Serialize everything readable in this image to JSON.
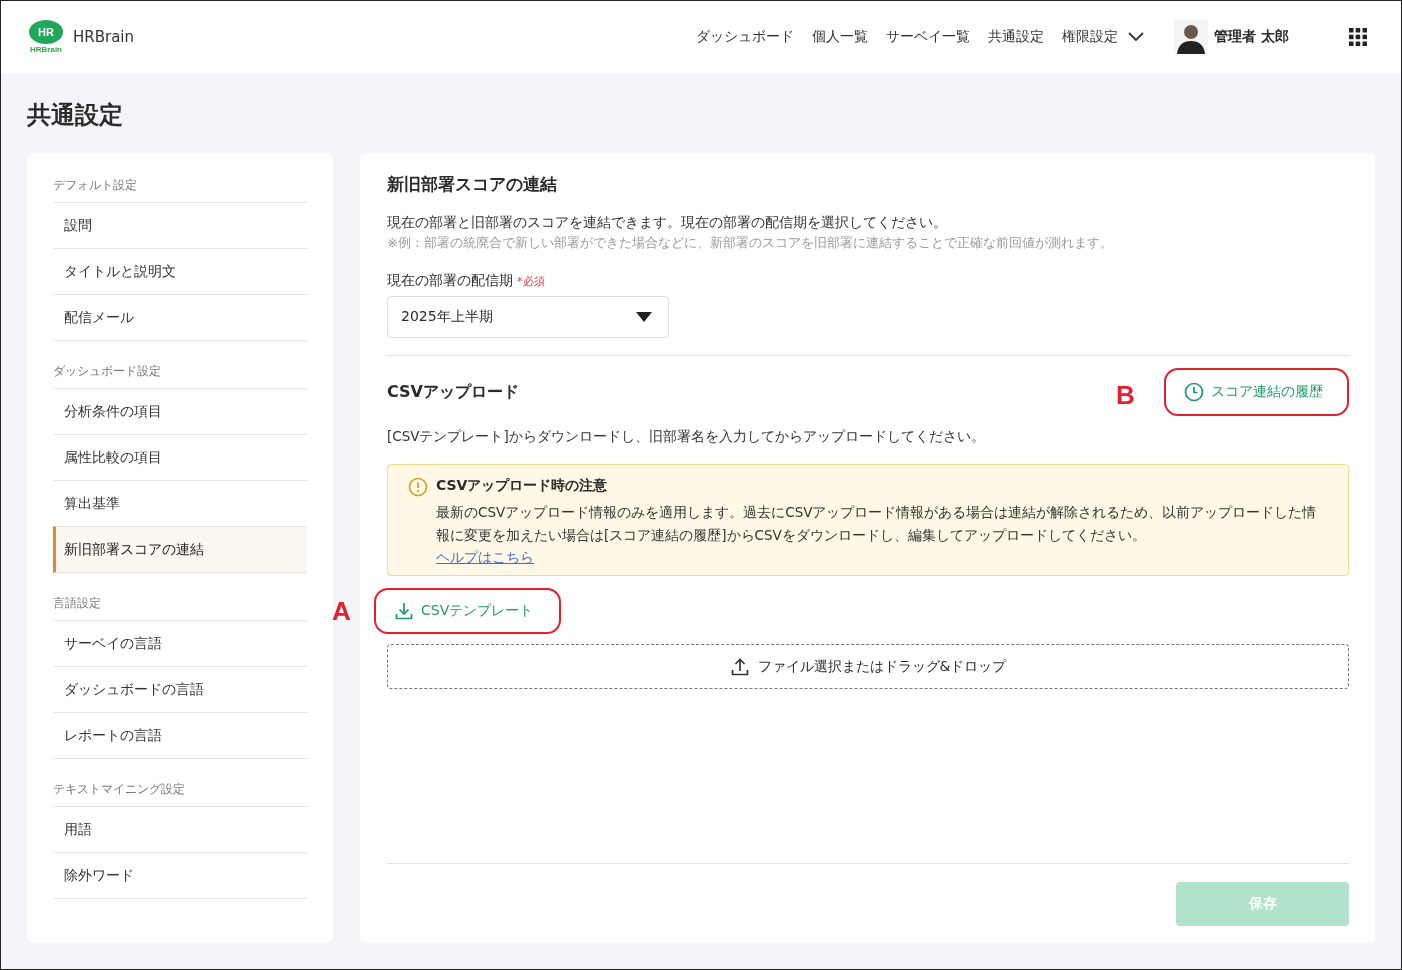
{
  "header": {
    "logo_mark": "HR",
    "logo_subtext": "HRBrain",
    "brand": "HRBrain",
    "nav": [
      {
        "label": "ダッシュボード",
        "dropdown": false
      },
      {
        "label": "個人一覧",
        "dropdown": false
      },
      {
        "label": "サーベイ一覧",
        "dropdown": false
      },
      {
        "label": "共通設定",
        "dropdown": false
      },
      {
        "label": "権限設定",
        "dropdown": true
      }
    ],
    "user": {
      "name": "管理者 太郎"
    }
  },
  "page_title": "共通設定",
  "sidebar": {
    "sections": [
      {
        "heading": "デフォルト設定",
        "items": [
          {
            "label": "設問",
            "selected": false
          },
          {
            "label": "タイトルと説明文",
            "selected": false
          },
          {
            "label": "配信メール",
            "selected": false
          }
        ]
      },
      {
        "heading": "ダッシュボード設定",
        "items": [
          {
            "label": "分析条件の項目",
            "selected": false
          },
          {
            "label": "属性比較の項目",
            "selected": false
          },
          {
            "label": "算出基準",
            "selected": false
          },
          {
            "label": "新旧部署スコアの連結",
            "selected": true
          }
        ]
      },
      {
        "heading": "言語設定",
        "items": [
          {
            "label": "サーベイの言語",
            "selected": false
          },
          {
            "label": "ダッシュボードの言語",
            "selected": false
          },
          {
            "label": "レポートの言語",
            "selected": false
          }
        ]
      },
      {
        "heading": "テキストマイニング設定",
        "items": [
          {
            "label": "用語",
            "selected": false
          },
          {
            "label": "除外ワード",
            "selected": false
          }
        ]
      }
    ]
  },
  "panel": {
    "title": "新旧部署スコアの連結",
    "description": "現在の部署と旧部署のスコアを連結できます。現在の部署の配信期を選択してください。",
    "note": "※例：部署の統廃合で新しい部署ができた場合などに、新部署のスコアを旧部署に連結することで正確な前回値が測れます。",
    "period_field": {
      "label": "現在の部署の配信期",
      "required": "*必須",
      "value": "2025年上半期"
    },
    "csv": {
      "title": "CSVアップロード",
      "history_button": {
        "label": "スコア連結の履歴",
        "callout": "B"
      },
      "instruction": "[CSVテンプレート]からダウンロードし、旧部署名を入力してからアップロードしてください。",
      "notice": {
        "title": "CSVアップロード時の注意",
        "body": "最新のCSVアップロード情報のみを適用します。過去にCSVアップロード情報がある場合は連結が解除されるため、以前アップロードした情報に変更を加えたい場合は[スコア連結の履歴]からCSVをダウンロードし、編集してアップロードしてください。",
        "link": "ヘルプはこちら"
      },
      "template_button": {
        "label": "CSVテンプレート",
        "callout": "A"
      },
      "dropzone": "ファイル選択またはドラッグ&ドロップ"
    },
    "save_button": {
      "label": "保存",
      "disabled": true
    }
  }
}
